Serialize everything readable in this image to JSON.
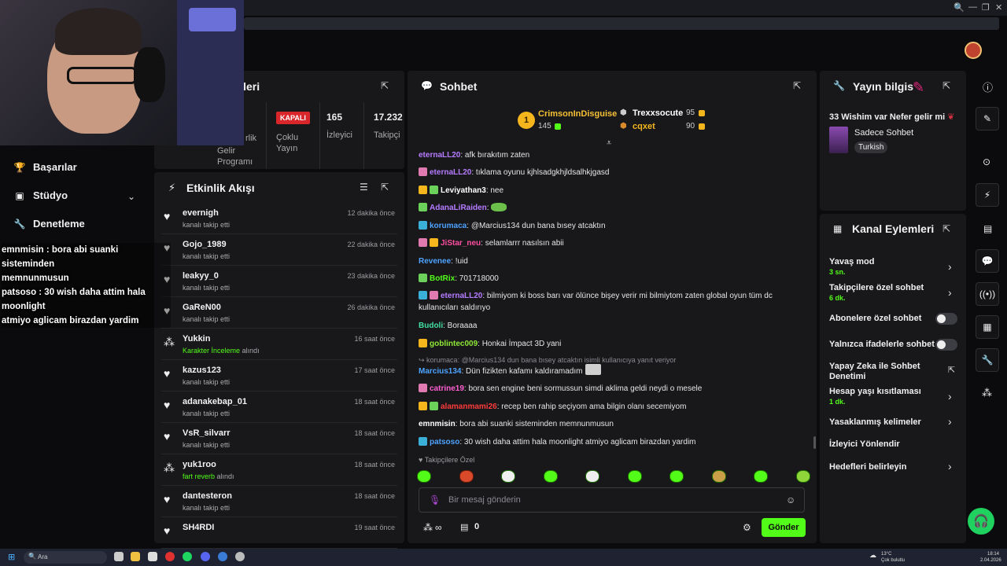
{
  "browser": {
    "controls": [
      "🔍",
      "—",
      "❐",
      "✕"
    ]
  },
  "leftnav": {
    "items": [
      {
        "label": "Başarılar",
        "icon": "trophy-icon"
      },
      {
        "label": "Stüdyo",
        "icon": "studio-icon"
      },
      {
        "label": "Denetleme",
        "icon": "wrench-icon"
      }
    ]
  },
  "overlay": {
    "lines": [
      "emnmisin : bora abi suanki sisteminden",
      "memnunmusun",
      "patsoso : 30 wish daha attim hala moonlight",
      "atmiyo aglicam birazdan yardim"
    ]
  },
  "stats": {
    "title": "stikleri",
    "partial_label_1": "rlik",
    "partial_label_2": "Gelir Programı",
    "kapali": "KAPALI",
    "coklu": "Çoklu Yayın",
    "viewers_value": "165",
    "viewers_label": "İzleyici",
    "followers_value": "17.232",
    "followers_label": "Takipçi"
  },
  "activity": {
    "title": "Etkinlik Akışı",
    "items": [
      {
        "name": "evernigh",
        "sub": "kanalı takip etti",
        "time": "12 dakika önce",
        "icon": "heart-icon"
      },
      {
        "name": "Gojo_1989",
        "sub": "kanalı takip etti",
        "time": "22 dakika önce",
        "icon": "heart-icon"
      },
      {
        "name": "leakyy_0",
        "sub": "kanalı takip etti",
        "time": "23 dakika önce",
        "icon": "heart-icon"
      },
      {
        "name": "GaReN00",
        "sub": "kanalı takip etti",
        "time": "26 dakika önce",
        "icon": "heart-icon"
      },
      {
        "name": "Yukkin",
        "sub_hl": "Karakter İnceleme",
        "sub": "alındı",
        "time": "16 saat önce",
        "icon": "points-icon"
      },
      {
        "name": "kazus123",
        "sub": "kanalı takip etti",
        "time": "17 saat önce",
        "icon": "heart-icon"
      },
      {
        "name": "adanakebap_01",
        "sub": "kanalı takip etti",
        "time": "18 saat önce",
        "icon": "heart-icon"
      },
      {
        "name": "VsR_silvarr",
        "sub": "kanalı takip etti",
        "time": "18 saat önce",
        "icon": "heart-icon"
      },
      {
        "name": "yuk1roo",
        "sub_hl": "fart reverb",
        "sub": "alındı",
        "time": "18 saat önce",
        "icon": "points-icon"
      },
      {
        "name": "dantesteron",
        "sub": "kanalı takip etti",
        "time": "18 saat önce",
        "icon": "heart-icon"
      },
      {
        "name": "SH4RDI",
        "sub": "",
        "time": "19 saat önce",
        "icon": "heart-icon"
      }
    ]
  },
  "chat": {
    "title": "Sohbet",
    "leaders": [
      {
        "name": "CrimsonInDisguise",
        "score": "145",
        "rank": "1"
      },
      {
        "name": "Trexxsocute",
        "score": "95"
      },
      {
        "name": "cqxet",
        "score": "90"
      }
    ],
    "messages": [
      {
        "user": "eternaLL20",
        "color": "#b57cff",
        "text": "afk bırakıtım zaten"
      },
      {
        "user": "eternaLL20",
        "color": "#b57cff",
        "text": "tıklama oyunu kjhlsadgkhjldsalhkjgasd"
      },
      {
        "user": "Leviyathan3",
        "color": "#ffffff",
        "text": "nee"
      },
      {
        "user": "AdanaLiRaiden",
        "color": "#b57cff",
        "text": ""
      },
      {
        "user": "korumaca",
        "color": "#4da3ff",
        "text": "@Marcius134 dun bana bısey atcaktın"
      },
      {
        "user": "JiStar_neu",
        "color": "#ff4fa0",
        "text": "selamlarrr nasılsın abii"
      },
      {
        "user": "Revenee",
        "color": "#4da3ff",
        "text": "!uid"
      },
      {
        "user": "BotRix",
        "color": "#53fc18",
        "text": "701718000"
      },
      {
        "user": "eternaLL20",
        "color": "#b57cff",
        "text": "bilmiyom ki boss barı var ölünce bişey verir mi bilmiytom zaten global oyun tüm dc kullanıcıları saldırıyo"
      },
      {
        "user": "Budoli",
        "color": "#43e0a0",
        "text": "Boraaaa"
      },
      {
        "user": "goblintec009",
        "color": "#8fe836",
        "text": "Honkai İmpact 3D yani"
      },
      {
        "reply": "korumaca: @Marcius134 dun bana bısey atcaktın isimli kullanıcıya yanıt veriyor"
      },
      {
        "user": "Marcius134",
        "color": "#4da3ff",
        "text": "Dün fizikten kafamı kaldıramadım"
      },
      {
        "user": "catrine19",
        "color": "#ff5fd0",
        "text": "bora sen engine beni sormussun simdi aklima geldi neydi o mesele"
      },
      {
        "user": "alamanmami26",
        "color": "#ff3b3b",
        "text": "recep ben rahip seçiyom ama bilgin olanı secemiyom"
      },
      {
        "user": "emnmisin",
        "color": "#ffffff",
        "text": "bora abi suanki sisteminden memnunmusun"
      },
      {
        "user": "patsoso",
        "color": "#4da3ff",
        "text": "30 wish daha attim hala moonlight atmiyo aglicam birazdan yardim"
      }
    ],
    "followers_only": "Takipçilere Özel",
    "input_placeholder": "Bir mesaj gönderin",
    "points": "∞",
    "count": "0",
    "send": "Gönder"
  },
  "stream_info": {
    "title": "Yayın bilgis",
    "stream_title": "33 Wishim var Nefer gelir mi",
    "category": "Sadece Sohbet",
    "tag": "Turkish"
  },
  "channel_actions": {
    "title": "Kanal Eylemleri",
    "slow_mode": {
      "label": "Yavaş mod",
      "value": "3 sn."
    },
    "followers_chat": {
      "label": "Takipçilere özel sohbet",
      "value": "6 dk."
    },
    "subs_chat": "Abonelere özel sohbet",
    "emotes_chat": "Yalnızca ifadelerle sohbet",
    "ai_moderation": "Yapay Zeka ile Sohbet Denetimi",
    "age_restriction": {
      "label": "Hesap yaşı kısıtlaması",
      "value": "1 dk."
    },
    "banned_words": "Yasaklanmış kelimeler",
    "redirect": "İzleyici Yönlendir",
    "goals": "Hedefleri belirleyin"
  },
  "taskbar": {
    "search": "Ara",
    "weather_temp": "13°C",
    "weather_desc": "Çok bulutlu",
    "time": "18:14",
    "date": "2.04.2026"
  }
}
